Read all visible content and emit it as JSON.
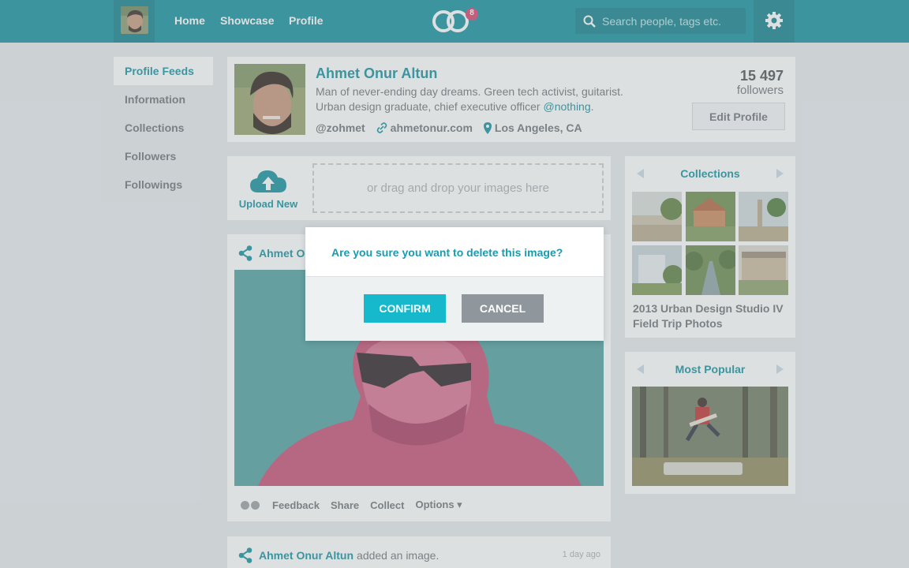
{
  "nav": {
    "home": "Home",
    "showcase": "Showcase",
    "profile": "Profile",
    "notification_count": "8",
    "search_placeholder": "Search people, tags etc."
  },
  "sidebar": {
    "items": [
      {
        "label": "Profile Feeds",
        "active": true
      },
      {
        "label": "Information"
      },
      {
        "label": "Collections"
      },
      {
        "label": "Followers"
      },
      {
        "label": "Followings"
      }
    ]
  },
  "profile": {
    "name": "Ahmet Onur Altun",
    "bio_1": "Man of never-ending day dreams. Green tech activist, guitarist.",
    "bio_2": "Urban design graduate, chief executive officer",
    "bio_mention": "@nothing",
    "bio_end": ".",
    "username": "@zohmet",
    "website": "ahmetonur.com",
    "location": "Los Angeles, CA",
    "followers_count": "15 497",
    "followers_label": "followers",
    "edit_label": "Edit Profile"
  },
  "upload": {
    "button_label": "Upload New",
    "dropzone_text": "or drag and drop your images here"
  },
  "post": {
    "author": "Ahmet Onur Altun",
    "actions": {
      "feedback": "Feedback",
      "share": "Share",
      "collect": "Collect",
      "options": "Options ▾"
    }
  },
  "post2": {
    "author": "Ahmet Onur Altun",
    "action_text": "added an image.",
    "time": "1 day ago"
  },
  "collections": {
    "title": "Collections",
    "album_line_1": "2013 Urban Design Studio IV",
    "album_line_2": "Field Trip Photos"
  },
  "popular": {
    "title": "Most Popular"
  },
  "modal": {
    "message": "Are you sure you want to delete this image?",
    "confirm": "CONFIRM",
    "cancel": "CANCEL"
  },
  "colors": {
    "brand": "#138f9c",
    "confirm": "#16b9cc",
    "cancel": "#8f979c"
  }
}
